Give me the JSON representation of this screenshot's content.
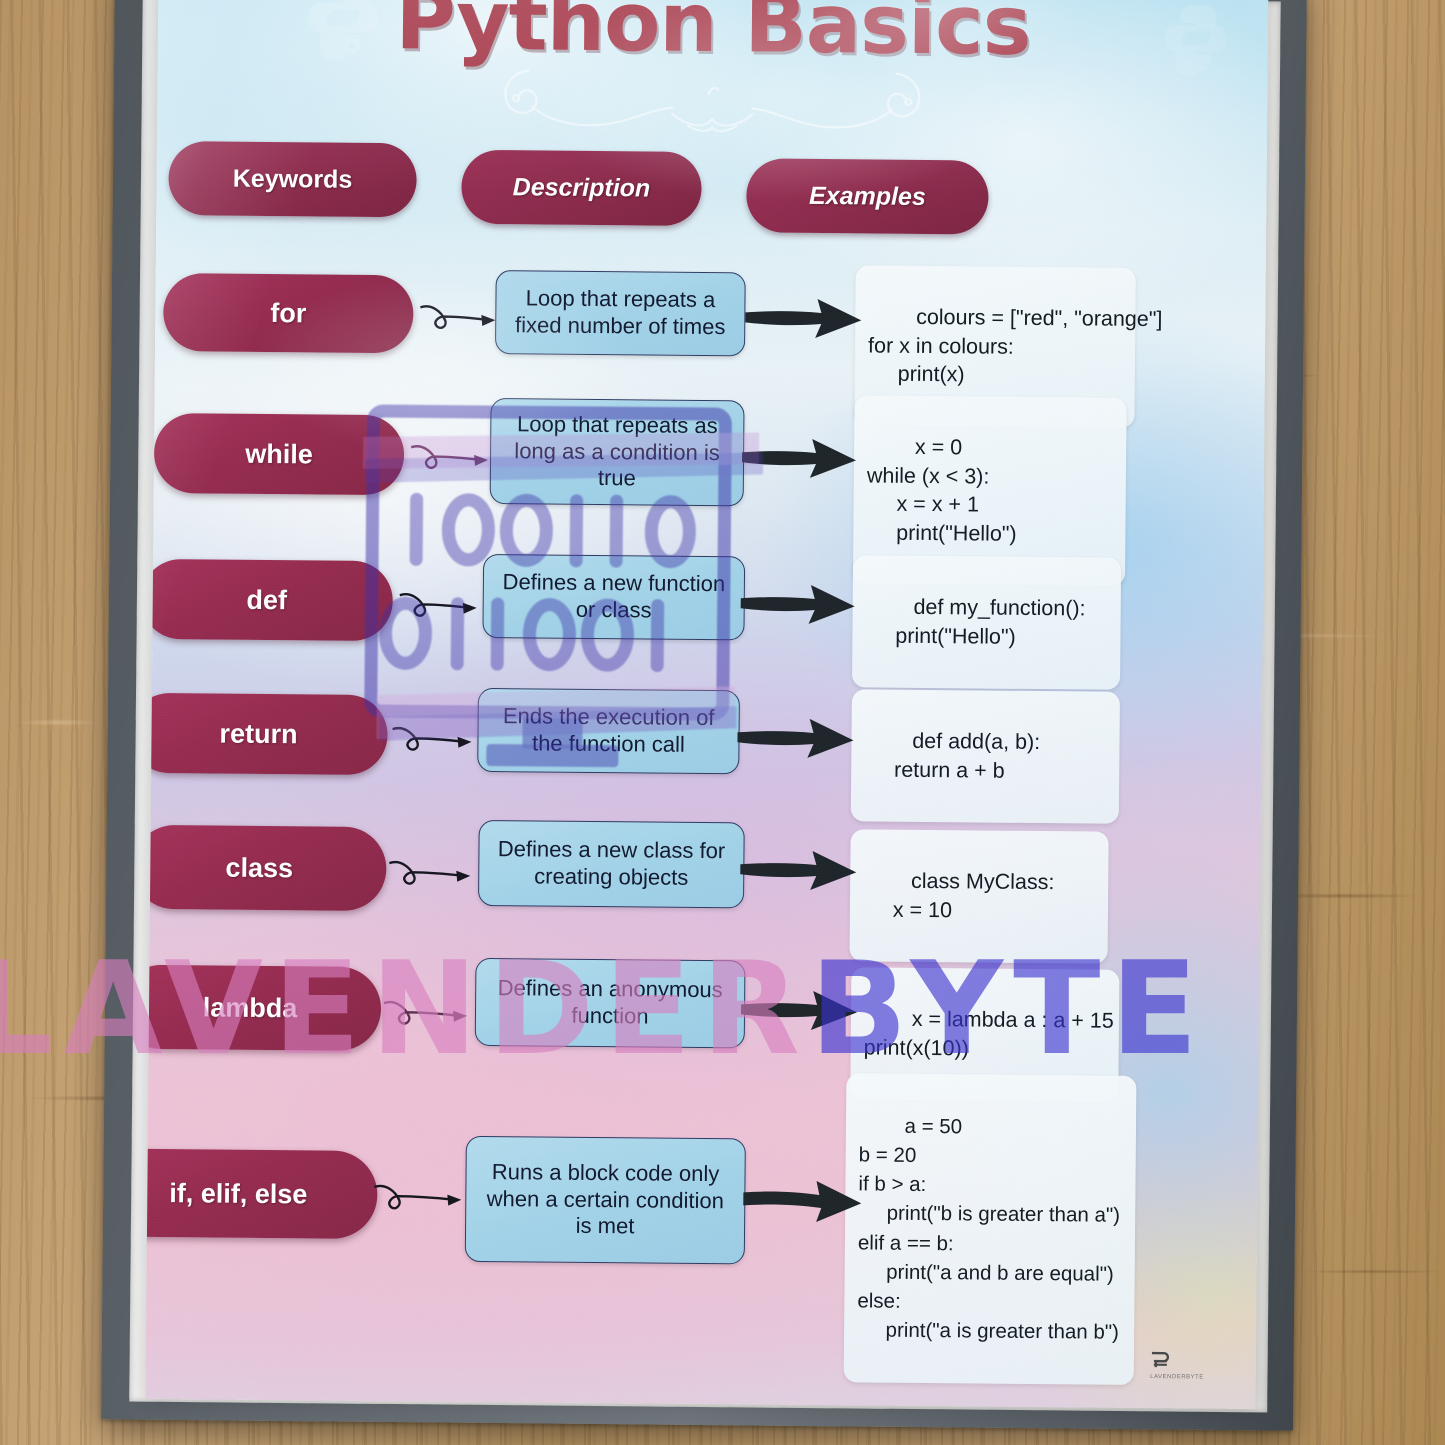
{
  "poster": {
    "title": "Python Basics",
    "headers": [
      {
        "label": "Keywords",
        "style": "normal"
      },
      {
        "label": "Description",
        "style": "italic"
      },
      {
        "label": "Examples",
        "style": "italic"
      }
    ],
    "rows": [
      {
        "keyword": "for",
        "description": "Loop that repeats a fixed number of times",
        "example": "colours = [\"red\", \"orange\"]\nfor x in colours:\n     print(x)"
      },
      {
        "keyword": "while",
        "description": "Loop that repeats as long as a condition is true",
        "example": "x = 0\nwhile (x < 3):\n     x = x + 1\n     print(\"Hello\")"
      },
      {
        "keyword": "def",
        "description": "Defines a new function or class",
        "example": "def my_function():\n     print(\"Hello\")"
      },
      {
        "keyword": "return",
        "description": "Ends the execution of the function call",
        "example": "def add(a, b):\n     return a + b"
      },
      {
        "keyword": "class",
        "description": "Defines a new class for creating objects",
        "example": "class MyClass:\n     x = 10"
      },
      {
        "keyword": "lambda",
        "description": "Defines an anonymous function",
        "example": "x = lambda a : a + 15\nprint(x(10))"
      },
      {
        "keyword": "if, elif, else",
        "description": "Runs a block code only when a certain condition is met",
        "example": "a = 50\nb = 20\nif b > a:\n     print(\"b is greater than a\")\nelif a == b:\n     print(\"a and b are equal\")\nelse:\n     print(\"a is greater than b\")"
      }
    ],
    "overlays": {
      "watermark_part1": "LAVENDER",
      "watermark_part2": "BYTE",
      "binary_line_1": "100110",
      "binary_line_2": "011001",
      "corner_logo_text": "LAVENDERBYTE"
    },
    "colors": {
      "keyword_pill": "#972b50",
      "header_pill": "#8e2a4d",
      "description_box": "#a2d3e9",
      "description_border": "#2b3a63",
      "example_box": "#eef6fa",
      "title_text": "#a93d4e",
      "watermark_pink": "#d87fc0",
      "watermark_blue": "#3b32cf",
      "frame": "#5d646a",
      "table_wood": "#c9a678"
    }
  }
}
